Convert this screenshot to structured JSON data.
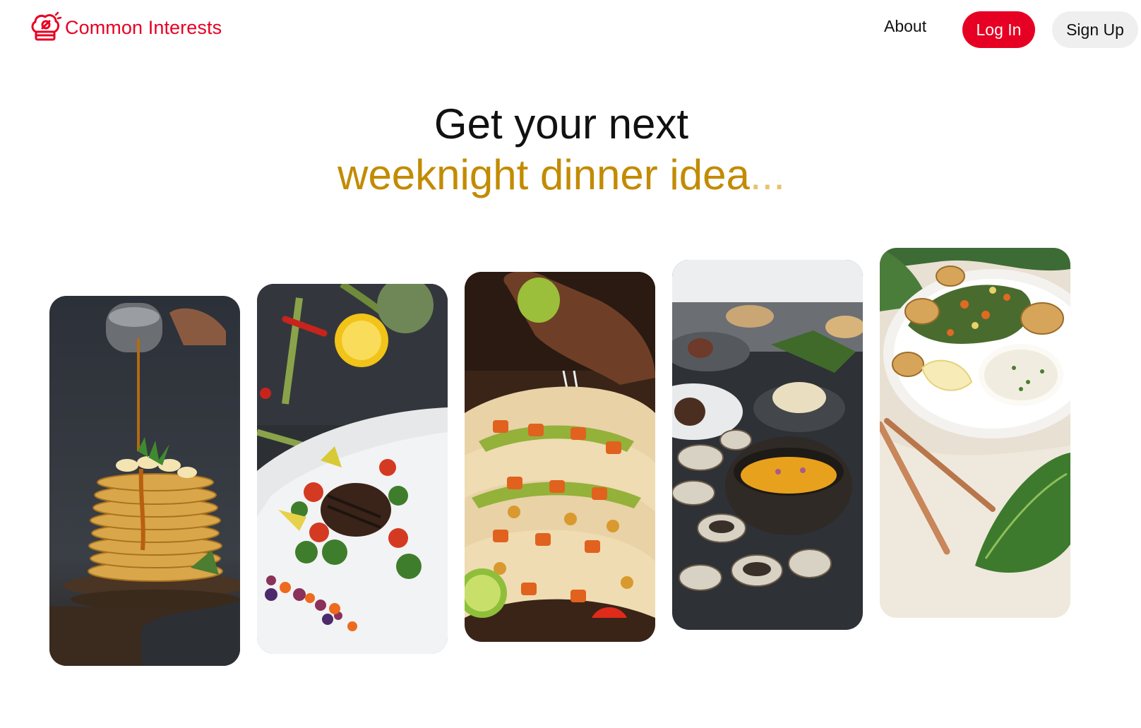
{
  "header": {
    "brand": "Common Interests",
    "nav_about": "About",
    "login_label": "Log In",
    "signup_label": "Sign Up"
  },
  "hero": {
    "line1": "Get your next",
    "line2": "weeknight dinner idea",
    "ellipsis": "..."
  },
  "gallery": [
    {
      "icon": "pancakes-syrup-photo"
    },
    {
      "icon": "steak-vegetables-plate-photo"
    },
    {
      "icon": "tacos-lime-photo"
    },
    {
      "icon": "clams-soup-table-photo"
    },
    {
      "icon": "fish-greens-plate-photo"
    }
  ],
  "colors": {
    "brand_red": "#e60023",
    "accent_gold": "#c28b00",
    "signup_bg": "#efefef"
  }
}
